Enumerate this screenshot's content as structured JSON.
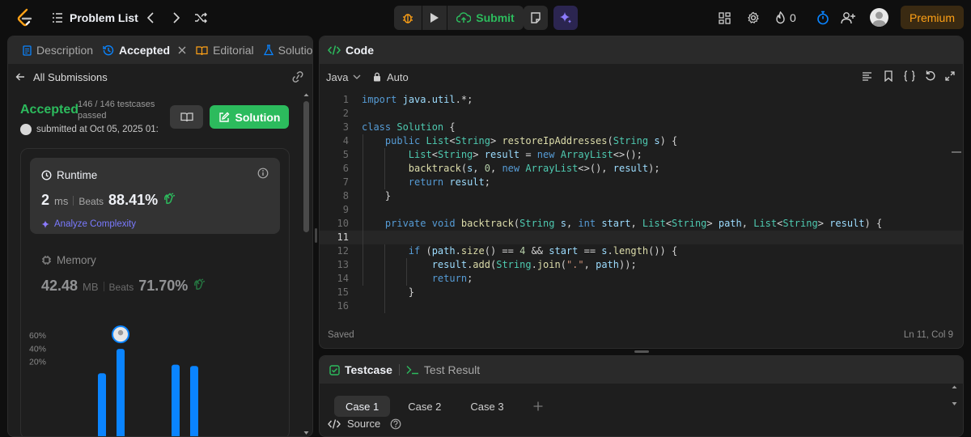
{
  "topbar": {
    "problem_list": "Problem List",
    "submit": "Submit",
    "streak": "0",
    "premium": "Premium"
  },
  "left": {
    "tabs": [
      "Description",
      "Accepted",
      "Editorial",
      "Solutio"
    ],
    "all_submissions": "All Submissions",
    "status": "Accepted",
    "testcases": "146 / 146 testcases passed",
    "submitted": "submitted at Oct 05, 2025 01:",
    "solution_btn": "Solution",
    "runtime": {
      "title": "Runtime",
      "value": "2",
      "unit": "ms",
      "beats_label": "Beats",
      "beats": "88.41%",
      "analyze": "Analyze Complexity"
    },
    "memory": {
      "title": "Memory",
      "value": "42.48",
      "unit": "MB",
      "beats_label": "Beats",
      "beats": "71.70%"
    }
  },
  "chart_data": {
    "type": "bar",
    "y_tick_labels": [
      "60%",
      "40%",
      "20%"
    ],
    "ylim": [
      0,
      60
    ],
    "x": [
      1,
      2,
      3,
      4,
      5
    ],
    "values": [
      2,
      39,
      0,
      15,
      13
    ],
    "highlight_index": 1,
    "bar_color": "#0a84ff"
  },
  "code": {
    "header": "Code",
    "language": "Java",
    "mode": "Auto",
    "status_saved": "Saved",
    "cursor_pos": "Ln 11, Col 9",
    "current_line": 11,
    "lines": [
      "import java.util.*;",
      "",
      "class Solution {",
      "    public List<String> restoreIpAddresses(String s) {",
      "        List<String> result = new ArrayList<>();",
      "        backtrack(s, 0, new ArrayList<>(), result);",
      "        return result;",
      "    }",
      "",
      "    private void backtrack(String s, int start, List<String> path, List<String> result) {",
      "",
      "        if (path.size() == 4 && start == s.length()) {",
      "            result.add(String.join(\".\", path));",
      "            return;",
      "        }",
      ""
    ]
  },
  "test": {
    "testcase": "Testcase",
    "test_result": "Test Result",
    "cases": [
      "Case 1",
      "Case 2",
      "Case 3"
    ],
    "source": "Source"
  },
  "colors": {
    "accent_green": "#2cbb5d",
    "premium_orange": "#ffa116",
    "panel_bg": "#1e1e1e"
  }
}
